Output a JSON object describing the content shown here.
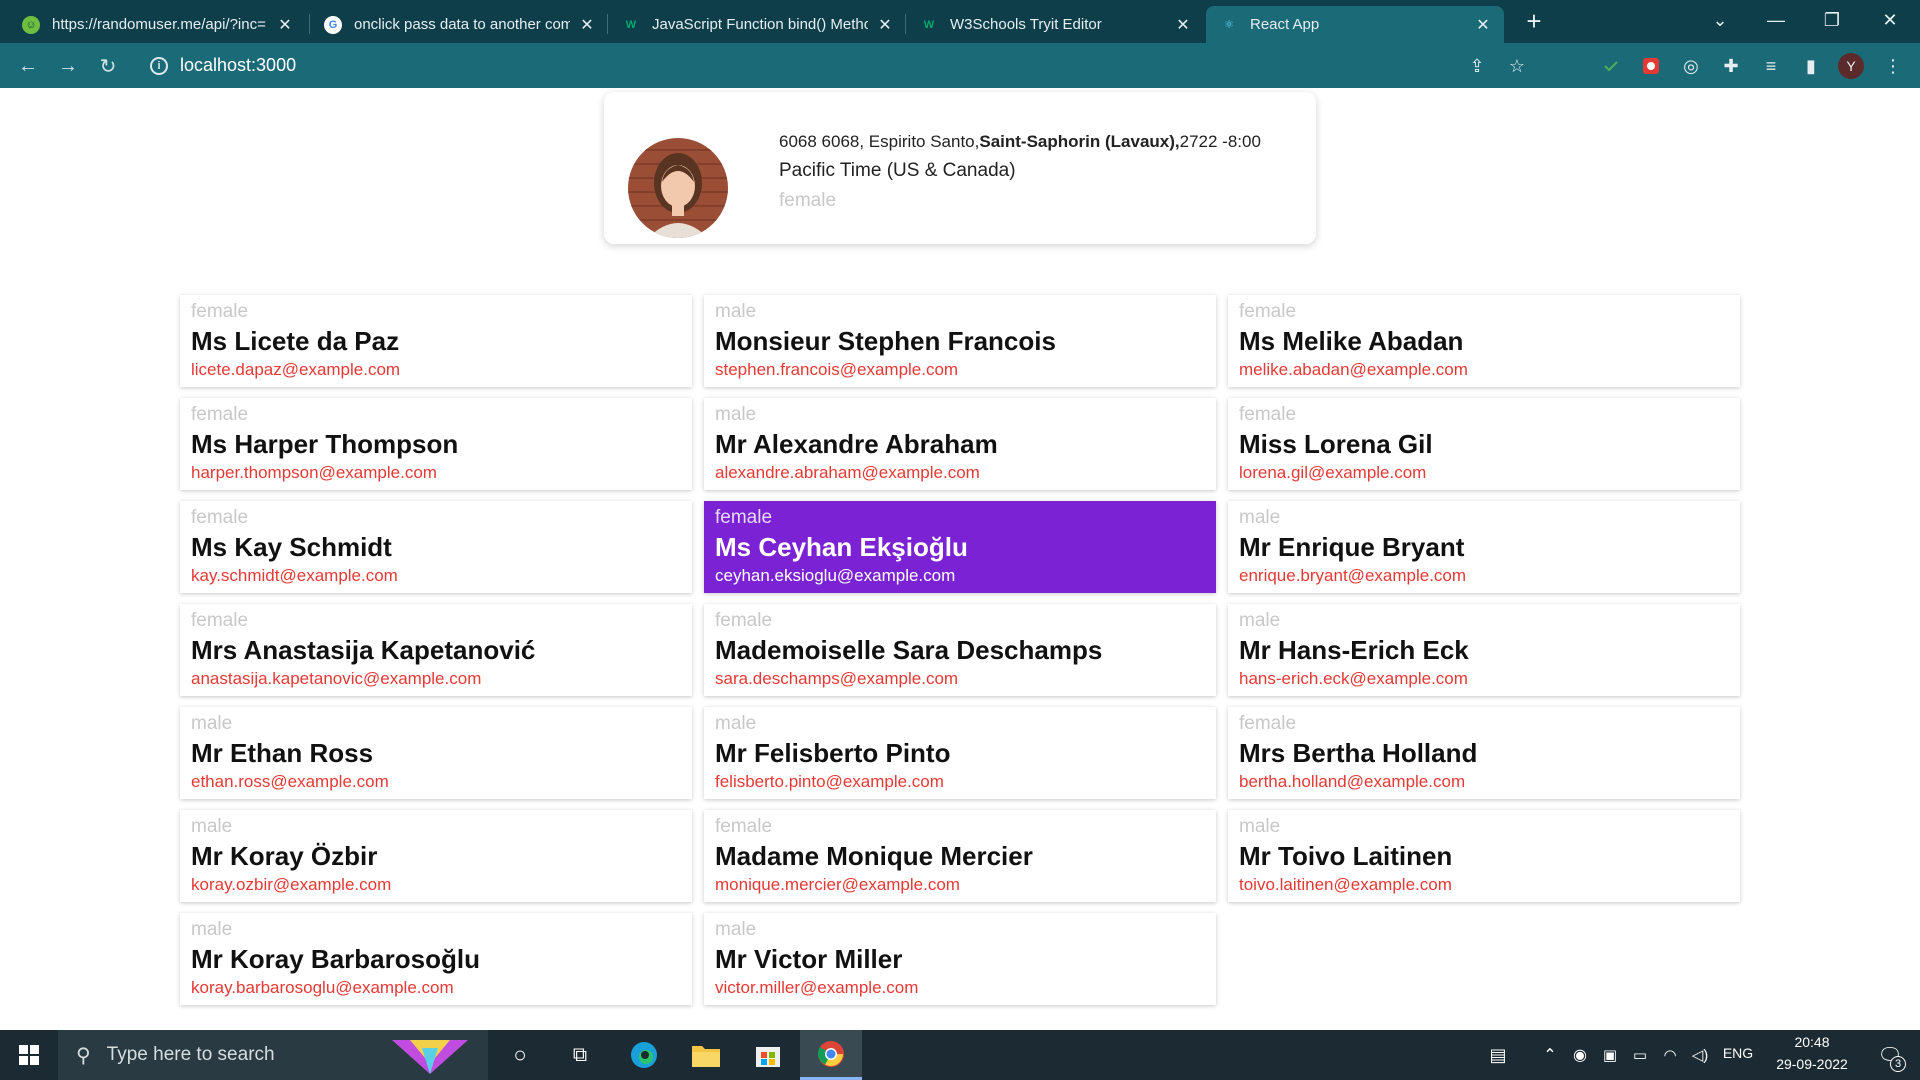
{
  "browser": {
    "tabs": [
      {
        "title": "https://randomuser.me/api/?inc=",
        "icon": "randomuser-favicon",
        "active": false
      },
      {
        "title": "onclick pass data to another com",
        "icon": "google-favicon",
        "active": false
      },
      {
        "title": "JavaScript Function bind() Metho",
        "icon": "w3schools-favicon",
        "active": false
      },
      {
        "title": "W3Schools Tryit Editor",
        "icon": "w3schools-favicon",
        "active": false
      },
      {
        "title": "React App",
        "icon": "react-favicon",
        "active": true
      }
    ],
    "url": "localhost:3000",
    "profile_initial": "Y"
  },
  "profile_card": {
    "address_prefix": "6068 6068, Espirito Santo,",
    "city": "Saint-Saphorin (Lavaux),",
    "postcode_tz": "2722 -8:00",
    "timezone_desc": "Pacific Time (US & Canada)",
    "gender": "female"
  },
  "users": [
    {
      "gender": "female",
      "name": "Ms Licete da Paz",
      "email": "licete.dapaz@example.com",
      "selected": false
    },
    {
      "gender": "male",
      "name": "Monsieur Stephen Francois",
      "email": "stephen.francois@example.com",
      "selected": false
    },
    {
      "gender": "female",
      "name": "Ms Melike Abadan",
      "email": "melike.abadan@example.com",
      "selected": false
    },
    {
      "gender": "female",
      "name": "Ms Harper Thompson",
      "email": "harper.thompson@example.com",
      "selected": false
    },
    {
      "gender": "male",
      "name": "Mr Alexandre Abraham",
      "email": "alexandre.abraham@example.com",
      "selected": false
    },
    {
      "gender": "female",
      "name": "Miss Lorena Gil",
      "email": "lorena.gil@example.com",
      "selected": false
    },
    {
      "gender": "female",
      "name": "Ms Kay Schmidt",
      "email": "kay.schmidt@example.com",
      "selected": false
    },
    {
      "gender": "female",
      "name": "Ms Ceyhan Ekşioğlu",
      "email": "ceyhan.eksioglu@example.com",
      "selected": true
    },
    {
      "gender": "male",
      "name": "Mr Enrique Bryant",
      "email": "enrique.bryant@example.com",
      "selected": false
    },
    {
      "gender": "female",
      "name": "Mrs Anastasija Kapetanović",
      "email": "anastasija.kapetanovic@example.com",
      "selected": false
    },
    {
      "gender": "female",
      "name": "Mademoiselle Sara Deschamps",
      "email": "sara.deschamps@example.com",
      "selected": false
    },
    {
      "gender": "male",
      "name": "Mr Hans-Erich Eck",
      "email": "hans-erich.eck@example.com",
      "selected": false
    },
    {
      "gender": "male",
      "name": "Mr Ethan Ross",
      "email": "ethan.ross@example.com",
      "selected": false
    },
    {
      "gender": "male",
      "name": "Mr Felisberto Pinto",
      "email": "felisberto.pinto@example.com",
      "selected": false
    },
    {
      "gender": "female",
      "name": "Mrs Bertha Holland",
      "email": "bertha.holland@example.com",
      "selected": false
    },
    {
      "gender": "male",
      "name": "Mr Koray Özbir",
      "email": "koray.ozbir@example.com",
      "selected": false
    },
    {
      "gender": "female",
      "name": "Madame Monique Mercier",
      "email": "monique.mercier@example.com",
      "selected": false
    },
    {
      "gender": "male",
      "name": "Mr Toivo Laitinen",
      "email": "toivo.laitinen@example.com",
      "selected": false
    },
    {
      "gender": "male",
      "name": "Mr Koray Barbarosoğlu",
      "email": "koray.barbarosoglu@example.com",
      "selected": false
    },
    {
      "gender": "male",
      "name": "Mr Victor Miller",
      "email": "victor.miller@example.com",
      "selected": false
    }
  ],
  "colors": {
    "tabstrip": "#0f3e4b",
    "toolbar": "#1b6a78",
    "selected_card": "#7b22d4",
    "email": "#e53935",
    "gender_text": "#c8c8c8"
  },
  "taskbar": {
    "search_placeholder": "Type here to search",
    "language": "ENG",
    "time": "20:48",
    "date": "29-09-2022",
    "notification_count": "3"
  }
}
